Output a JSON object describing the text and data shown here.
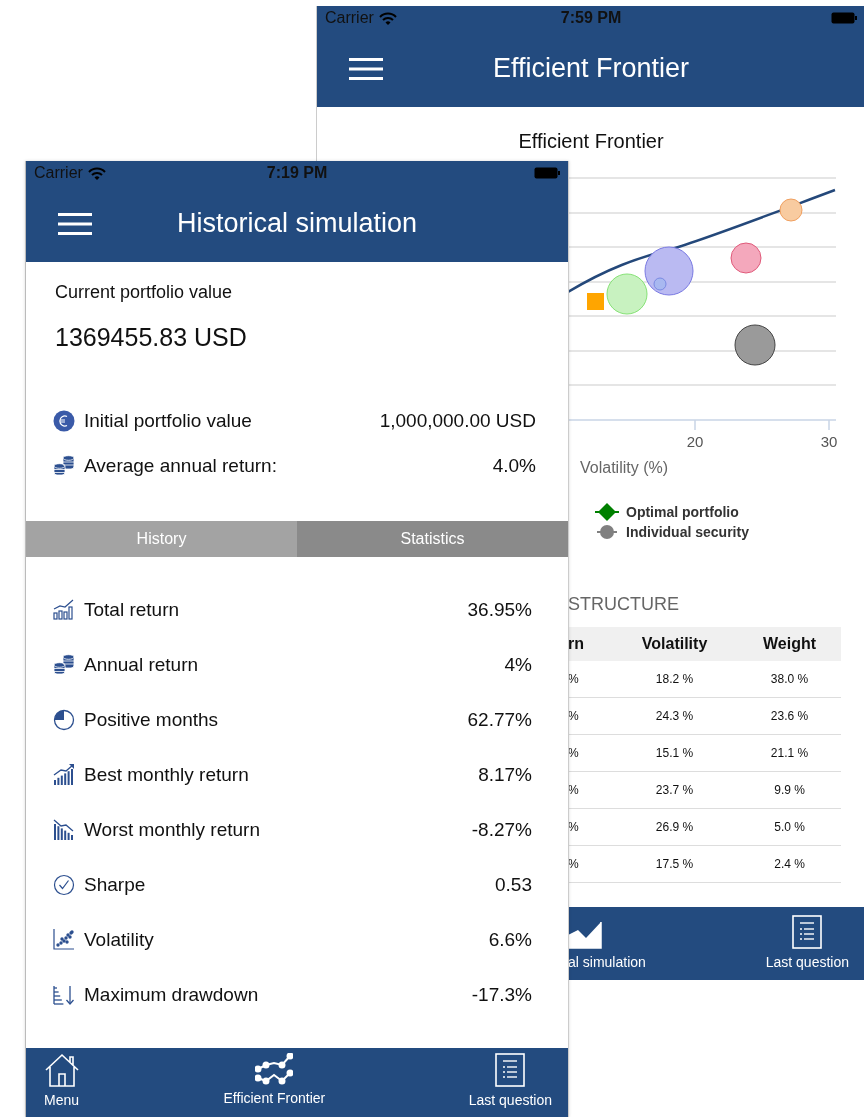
{
  "back_screen": {
    "status_bar": {
      "carrier": "Carrier",
      "time": "7:59 PM"
    },
    "nav_bar": {
      "title": "Efficient Frontier"
    },
    "chart": {
      "title": "Efficient Frontier",
      "x_tick_labels": [
        "20",
        "30"
      ],
      "xlabel": "Volatility (%)",
      "legend": [
        {
          "label": "Optimal portfolio",
          "kind": "diamond",
          "color": "#008000"
        },
        {
          "label": "Individual security",
          "kind": "circle",
          "color": "#808080"
        }
      ]
    },
    "structure": {
      "heading": "STRUCTURE",
      "columns": [
        "rn",
        "Volatility",
        "Weight"
      ],
      "rows": [
        [
          "%",
          "18.2 %",
          "38.0 %"
        ],
        [
          "%",
          "24.3 %",
          "23.6 %"
        ],
        [
          "%",
          "15.1 %",
          "21.1 %"
        ],
        [
          "%",
          "23.7 %",
          "9.9 %"
        ],
        [
          "%",
          "26.9 %",
          "5.0 %"
        ],
        [
          "%",
          "17.5 %",
          "2.4 %"
        ]
      ]
    },
    "tab_bar": [
      {
        "label": "al simulation"
      },
      {
        "label": "Last question"
      }
    ]
  },
  "front_screen": {
    "status_bar": {
      "carrier": "Carrier",
      "time": "7:19 PM"
    },
    "nav_bar": {
      "title": "Historical simulation"
    },
    "current": {
      "label": "Current portfolio value",
      "value": "1369455.83 USD"
    },
    "summary": [
      {
        "label": "Initial portfolio value",
        "value": "1,000,000.00 USD"
      },
      {
        "label": "Average annual return:",
        "value": "4.0%"
      }
    ],
    "tabs": [
      {
        "label": "History",
        "selected": false
      },
      {
        "label": "Statistics",
        "selected": true
      }
    ],
    "statistics": [
      {
        "label": "Total return",
        "value": "36.95%"
      },
      {
        "label": "Annual return",
        "value": "4%"
      },
      {
        "label": "Positive months",
        "value": "62.77%"
      },
      {
        "label": "Best monthly return",
        "value": "8.17%"
      },
      {
        "label": "Worst monthly return",
        "value": "-8.27%"
      },
      {
        "label": "Sharpe",
        "value": "0.53"
      },
      {
        "label": "Volatility",
        "value": "6.6%"
      },
      {
        "label": "Maximum drawdown",
        "value": "-17.3%"
      }
    ],
    "tab_bar": [
      {
        "label": "Menu"
      },
      {
        "label": "Efficient Frontier"
      },
      {
        "label": "Last question"
      }
    ]
  }
}
